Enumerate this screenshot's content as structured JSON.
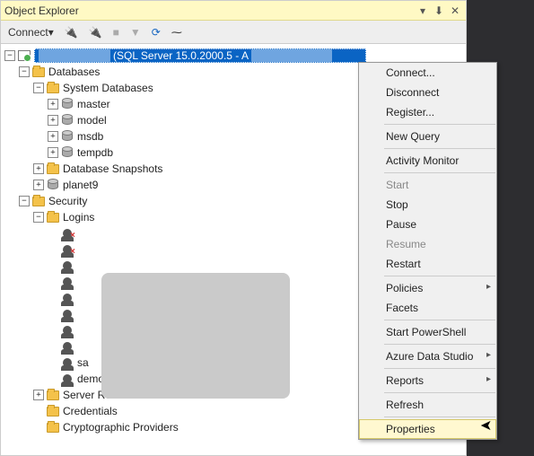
{
  "title": "Object Explorer",
  "toolbar": {
    "connect": "Connect"
  },
  "tree": {
    "server_suffix": " (SQL Server 15.0.2000.5 - A",
    "databases": "Databases",
    "sysdb": "System Databases",
    "master": "master",
    "model": "model",
    "msdb": "msdb",
    "tempdb": "tempdb",
    "snapshots": "Database Snapshots",
    "planet9": "planet9",
    "security": "Security",
    "logins": "Logins",
    "sa": "sa",
    "demosql": "demosql",
    "serverroles": "Server Roles",
    "credentials": "Credentials",
    "crypto": "Cryptographic Providers"
  },
  "menu": {
    "connect": "Connect...",
    "disconnect": "Disconnect",
    "register": "Register...",
    "newquery": "New Query",
    "activity": "Activity Monitor",
    "start": "Start",
    "stop": "Stop",
    "pause": "Pause",
    "resume": "Resume",
    "restart": "Restart",
    "policies": "Policies",
    "facets": "Facets",
    "powershell": "Start PowerShell",
    "azure": "Azure Data Studio",
    "reports": "Reports",
    "refresh": "Refresh",
    "properties": "Properties"
  }
}
